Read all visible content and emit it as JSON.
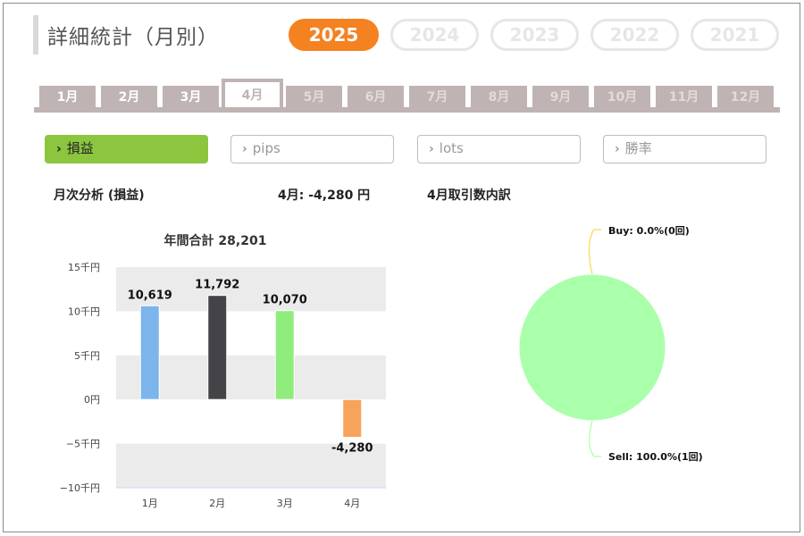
{
  "header": {
    "title": "詳細統計（月別）"
  },
  "years": [
    {
      "label": "2025",
      "active": true
    },
    {
      "label": "2024",
      "active": false
    },
    {
      "label": "2023",
      "active": false
    },
    {
      "label": "2022",
      "active": false
    },
    {
      "label": "2021",
      "active": false
    }
  ],
  "months": [
    {
      "label": "1月",
      "state": "normal"
    },
    {
      "label": "2月",
      "state": "normal"
    },
    {
      "label": "3月",
      "state": "normal"
    },
    {
      "label": "4月",
      "state": "active"
    },
    {
      "label": "5月",
      "state": "disabled"
    },
    {
      "label": "6月",
      "state": "disabled"
    },
    {
      "label": "7月",
      "state": "disabled"
    },
    {
      "label": "8月",
      "state": "disabled"
    },
    {
      "label": "9月",
      "state": "disabled"
    },
    {
      "label": "10月",
      "state": "disabled"
    },
    {
      "label": "11月",
      "state": "disabled"
    },
    {
      "label": "12月",
      "state": "disabled"
    }
  ],
  "filters": [
    {
      "label": "損益",
      "active": true
    },
    {
      "label": "pips",
      "active": false
    },
    {
      "label": "lots",
      "active": false
    },
    {
      "label": "勝率",
      "active": false
    }
  ],
  "summary": {
    "analysis_label": "月次分析 (損益)",
    "month_result": "4月:  -4,280 円",
    "breakdown_label": "4月取引数内訳"
  },
  "colors": {
    "accent": "#f58220",
    "filter_active": "#8cc63f",
    "tab": "#bfb3b3"
  },
  "chart_data": [
    {
      "type": "bar",
      "title": "年間合計 28,201",
      "categories": [
        "1月",
        "2月",
        "3月",
        "4月"
      ],
      "values": [
        10619,
        11792,
        10070,
        -4280
      ],
      "value_labels": [
        "10,619",
        "11,792",
        "10,070",
        "-4,280"
      ],
      "colors": [
        "#7cb5ec",
        "#434348",
        "#90ed7d",
        "#f7a35c"
      ],
      "ylim": [
        -10000,
        15000
      ],
      "yticks": [
        15000,
        10000,
        5000,
        0,
        -5000,
        -10000
      ],
      "ytick_labels": [
        "15千円",
        "10千円",
        "5千円",
        "0円",
        "−5千円",
        "−10千円"
      ],
      "xlabel": "",
      "ylabel": "",
      "grid": "alternating bands"
    },
    {
      "type": "pie",
      "slices": [
        {
          "name": "Buy",
          "value": 0,
          "label": "Buy: 0.0%(0回)",
          "color": "#f7d94c"
        },
        {
          "name": "Sell",
          "value": 100,
          "label": "Sell: 100.0%(1回)",
          "color": "#aaffaa"
        }
      ]
    }
  ]
}
